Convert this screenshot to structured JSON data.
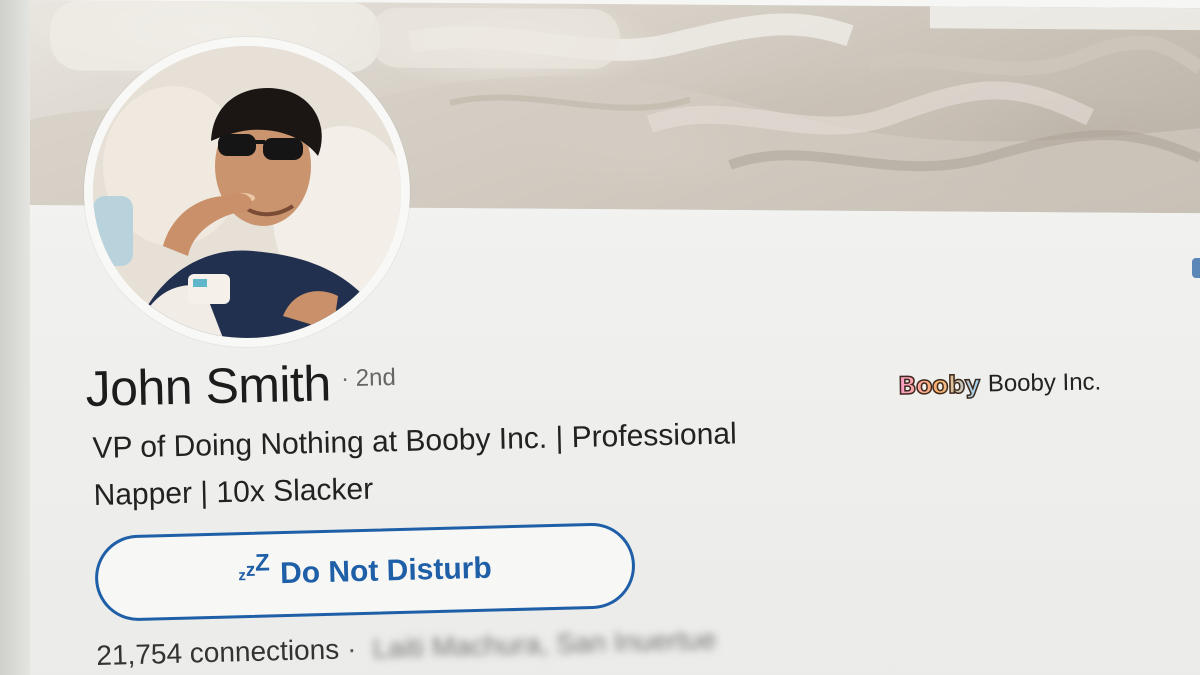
{
  "profile": {
    "name": "John Smith",
    "degree": "· 2nd",
    "headline": "VP of Doing Nothing at Booby Inc. | Professional Napper | 10x Slacker",
    "connections": "21,754 connections",
    "separator": "·",
    "location": "Laiti Machura, San Inuertue"
  },
  "status_button": {
    "icon": "zzz-sleep-icon",
    "icon_text_1": "z",
    "icon_text_2": "z",
    "icon_text_3": "Z",
    "label": "Do Not Disturb"
  },
  "company": {
    "logo_text": "Booby",
    "name": "Booby Inc."
  },
  "colors": {
    "accent": "#1f5fa8",
    "text_primary": "#1c1c1c",
    "text_secondary": "#666666"
  }
}
